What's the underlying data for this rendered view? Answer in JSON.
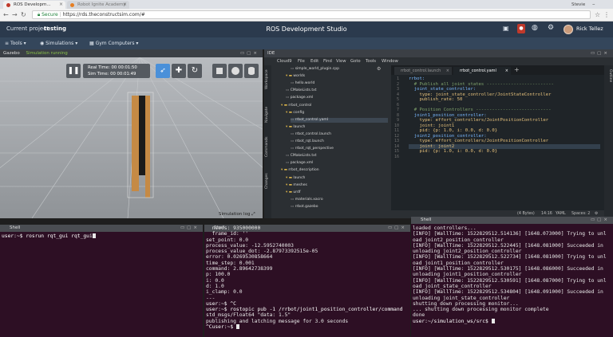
{
  "browser": {
    "tabs": [
      {
        "label": "ROS Developm..."
      },
      {
        "label": "Robot Ignite Academy"
      }
    ],
    "profile_label": "Stevie",
    "address": {
      "secure_label": "Secure",
      "url": "https://rds.theconstructsim.com/#"
    }
  },
  "header": {
    "project_label": "Current project:",
    "project_name": "testing",
    "title": "ROS Development Studio",
    "user_name": "Rick Tellez"
  },
  "toolbar": {
    "tools": "Tools",
    "simulations": "Simulations",
    "gym": "Gym Computers"
  },
  "gazebo": {
    "title": "Gazebo",
    "status": "Simulation running",
    "real_time_label": "Real Time:",
    "real_time": "00 00:01:50",
    "sim_time_label": "Sim Time:",
    "sim_time": "00 00:01:49",
    "log_label": "Simulation log"
  },
  "ide": {
    "title": "IDE",
    "menu": [
      "Cloud9",
      "File",
      "Edit",
      "Find",
      "View",
      "Goto",
      "Tools",
      "Window"
    ],
    "side_tabs": [
      "Workspace",
      "Navigate",
      "Commands",
      "Changes"
    ],
    "right_tab": "Outline",
    "tree": [
      {
        "label": "simple_world_plugin.cpp",
        "depth": 3,
        "kind": "file"
      },
      {
        "label": "worlds",
        "depth": 2,
        "kind": "folder"
      },
      {
        "label": "hello.world",
        "depth": 3,
        "kind": "file"
      },
      {
        "label": "CMakeLists.txt",
        "depth": 2,
        "kind": "file"
      },
      {
        "label": "package.xml",
        "depth": 2,
        "kind": "file"
      },
      {
        "label": "rrbot_control",
        "depth": 1,
        "kind": "folder"
      },
      {
        "label": "config",
        "depth": 2,
        "kind": "folder"
      },
      {
        "label": "rrbot_control.yaml",
        "depth": 3,
        "kind": "file"
      },
      {
        "label": "launch",
        "depth": 2,
        "kind": "folder"
      },
      {
        "label": "rrbot_control.launch",
        "depth": 3,
        "kind": "file"
      },
      {
        "label": "rrbot_rqt.launch",
        "depth": 3,
        "kind": "file"
      },
      {
        "label": "rrbot_rqt_perspective",
        "depth": 3,
        "kind": "file"
      },
      {
        "label": "CMakeLists.txt",
        "depth": 2,
        "kind": "file"
      },
      {
        "label": "package.xml",
        "depth": 2,
        "kind": "file"
      },
      {
        "label": "rrbot_description",
        "depth": 1,
        "kind": "folder"
      },
      {
        "label": "launch",
        "depth": 2,
        "kind": "folder"
      },
      {
        "label": "meshes",
        "depth": 2,
        "kind": "folder"
      },
      {
        "label": "urdf",
        "depth": 2,
        "kind": "folder"
      },
      {
        "label": "materials.xacro",
        "depth": 3,
        "kind": "file"
      },
      {
        "label": "rrbot.gazebo",
        "depth": 3,
        "kind": "file"
      }
    ],
    "editor_tabs": [
      {
        "label": "rrbot_control.launch"
      },
      {
        "label": "rrbot_control.yaml"
      }
    ],
    "code": [
      "rrbot:",
      "  # Publish all joint states -------------------------",
      "  joint_state_controller:",
      "    type: joint_state_controller/JointStateController",
      "    publish_rate: 50",
      "",
      "  # Position Controllers ----------------------------",
      "  joint1_position_controller:",
      "    type: effort_controllers/JointPositionController",
      "    joint: joint1",
      "    pid: {p: 1.0, i: 0.0, d: 0.0}",
      "  joint2_position_controller:",
      "    type: effort_controllers/JointPositionController",
      "    joint: joint2",
      "    pid: {p: 1.0, i: 0.0, d: 0.0}"
    ],
    "line_numbers": [
      "1",
      "2",
      "3",
      "4",
      "5",
      "6",
      "7",
      "8",
      "9",
      "10",
      "11",
      "12",
      "13",
      "14",
      "15",
      "16"
    ],
    "status": {
      "bytes": "(4 Bytes)",
      "pos": "14:16",
      "lang": "YAML",
      "spaces": "Spaces: 2"
    }
  },
  "shell1": {
    "title": "Shell",
    "lines": [
      "user:~$ rosrun rqt_gui rqt_gui"
    ]
  },
  "shell2": {
    "title": "Shell",
    "lines": [
      "  nsecs: 935000000",
      "  frame_id: ''",
      "set_point: 0.0",
      "process_value: -12.5952740003",
      "process_value_dot: -2.87973392515e-05",
      "error: 0.0269530858664",
      "time_step: 0.001",
      "command: 2.89642738399",
      "p: 100.0",
      "i: 0.0",
      "d: 1.0",
      "i_clamp: 0.0",
      "---",
      "user:~$ ^C",
      "user:~$ rostopic pub -1 /rrbot/joint1_position_controller/command",
      "std_msgs/Float64 \"data: 1.5\"",
      "publishing and latching message for 3.0 seconds",
      "^Cuser:~$ "
    ]
  },
  "shell3": {
    "title": "Shell",
    "lines": [
      "loaded controllers...",
      "[INFO] [WallTime: 1522829512.514136] [1648.073000] Trying to unl",
      "oad joint2_position_controller",
      "[INFO] [WallTime: 1522829512.522445] [1648.081000] Succeeded in",
      "unloading joint2_position_controller",
      "[INFO] [WallTime: 1522829512.522734] [1648.081000] Trying to unl",
      "oad joint1_position_controller",
      "[INFO] [WallTime: 1522829512.530175] [1648.086000] Succeeded in",
      "unloading joint1_position_controller",
      "[INFO] [WallTime: 1522829512.530591] [1648.087000] Trying to unl",
      "oad joint_state_controller",
      "[INFO] [WallTime: 1522829512.534804] [1648.091000] Succeeded in",
      "unloading joint_state_controller",
      "shutting down processing monitor...",
      "... shutting down processing monitor complete",
      "done",
      "user:~/simulation_ws/src$ "
    ]
  },
  "colors": {
    "header_bg": "#2b3a4d",
    "terminal_bg": "#2d0f24",
    "accent": "#4a90d9",
    "robot_link": "#c58a45",
    "robot_joint_dark": "#1b1b1b"
  }
}
